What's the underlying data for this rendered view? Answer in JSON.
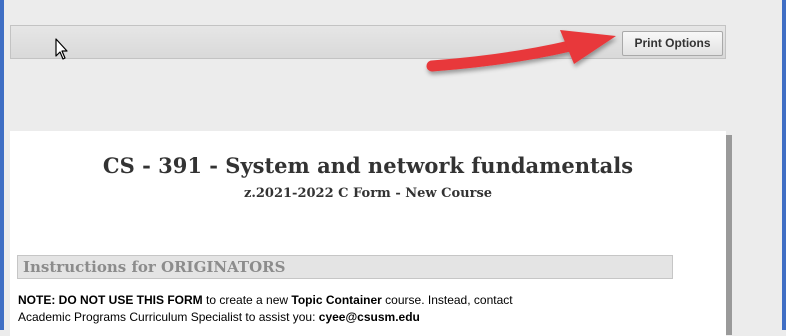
{
  "toolbar": {
    "print_options_label": "Print Options"
  },
  "document": {
    "title": "CS - 391 - System and network fundamentals",
    "subtitle": "z.2021-2022 C Form - New Course",
    "section_header": "Instructions for ORIGINATORS",
    "note": {
      "bold_prefix": "NOTE: DO NOT USE THIS FORM",
      "text1": " to create a new ",
      "bold_topic": "Topic Container",
      "text2": " course. Instead, contact",
      "line2": "Academic Programs Curriculum Specialist to assist you: ",
      "email": "cyee@csusm.edu"
    }
  },
  "annotation": {
    "arrow_color": "#e8373a"
  },
  "colors": {
    "frame_blue": "#3f6ec4"
  }
}
